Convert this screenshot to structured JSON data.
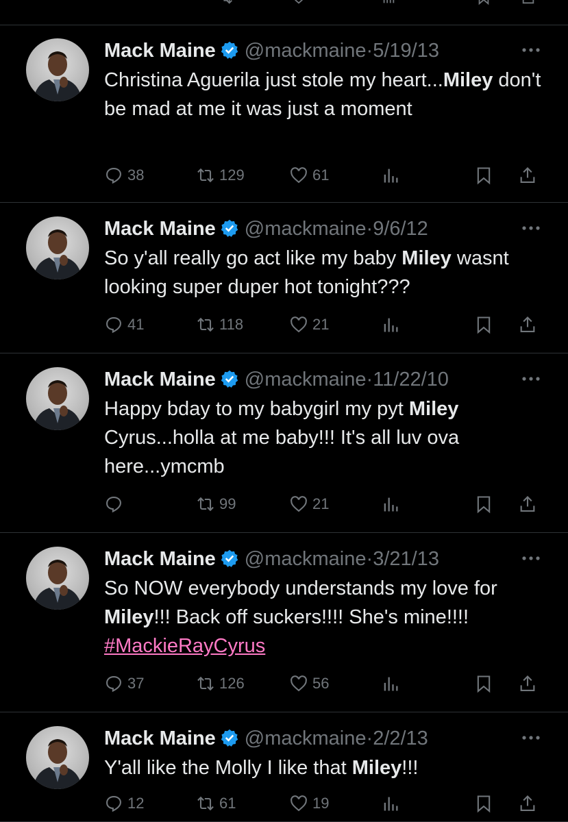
{
  "theme": {
    "background": "#000000",
    "text": "#e7e9ea",
    "muted": "#71767b",
    "verified": "#1d9bf0",
    "hashtag": "#ff7ac6"
  },
  "icons": {
    "reply": "reply-icon",
    "retweet": "retweet-icon",
    "like": "heart-icon",
    "views": "views-icon",
    "bookmark": "bookmark-icon",
    "share": "share-icon",
    "verified": "verified-badge-icon",
    "more": "more-icon"
  },
  "tweets": [
    {
      "name": "Mack Maine",
      "handle": "@mackmaine",
      "sep": "·",
      "date": "5/19/13",
      "text": [
        {
          "t": "Christina Aguerila just stole my heart..."
        },
        {
          "t": "Miley",
          "bold": true
        },
        {
          "t": " don't be mad at me it was just a moment"
        }
      ],
      "replies": "38",
      "retweets": "129",
      "likes": "61"
    },
    {
      "name": "Mack Maine",
      "handle": "@mackmaine",
      "sep": "·",
      "date": "9/6/12",
      "text": [
        {
          "t": "So y'all really go act like my baby "
        },
        {
          "t": "Miley",
          "bold": true
        },
        {
          "t": " wasnt looking super duper hot tonight???"
        }
      ],
      "replies": "41",
      "retweets": "118",
      "likes": "21"
    },
    {
      "name": "Mack Maine",
      "handle": "@mackmaine",
      "sep": "·",
      "date": "11/22/10",
      "text": [
        {
          "t": "Happy bday to my babygirl my pyt "
        },
        {
          "t": "Miley",
          "bold": true
        },
        {
          "t": " Cyrus...holla at me baby!!! It's all luv ova here...ymcmb"
        }
      ],
      "replies": "",
      "retweets": "99",
      "likes": "21"
    },
    {
      "name": "Mack Maine",
      "handle": "@mackmaine",
      "sep": "·",
      "date": "3/21/13",
      "text": [
        {
          "t": "So NOW everybody understands my love for "
        },
        {
          "t": "Miley",
          "bold": true
        },
        {
          "t": "!!! Back off suckers!!!! She's mine!!!! "
        },
        {
          "t": "#MackieRayCyrus",
          "hashtag": true
        }
      ],
      "replies": "37",
      "retweets": "126",
      "likes": "56"
    },
    {
      "name": "Mack Maine",
      "handle": "@mackmaine",
      "sep": "·",
      "date": "2/2/13",
      "text": [
        {
          "t": "Y'all like the Molly I like that "
        },
        {
          "t": "Miley",
          "bold": true
        },
        {
          "t": "!!!"
        }
      ],
      "replies": "12",
      "retweets": "61",
      "likes": "19"
    }
  ]
}
